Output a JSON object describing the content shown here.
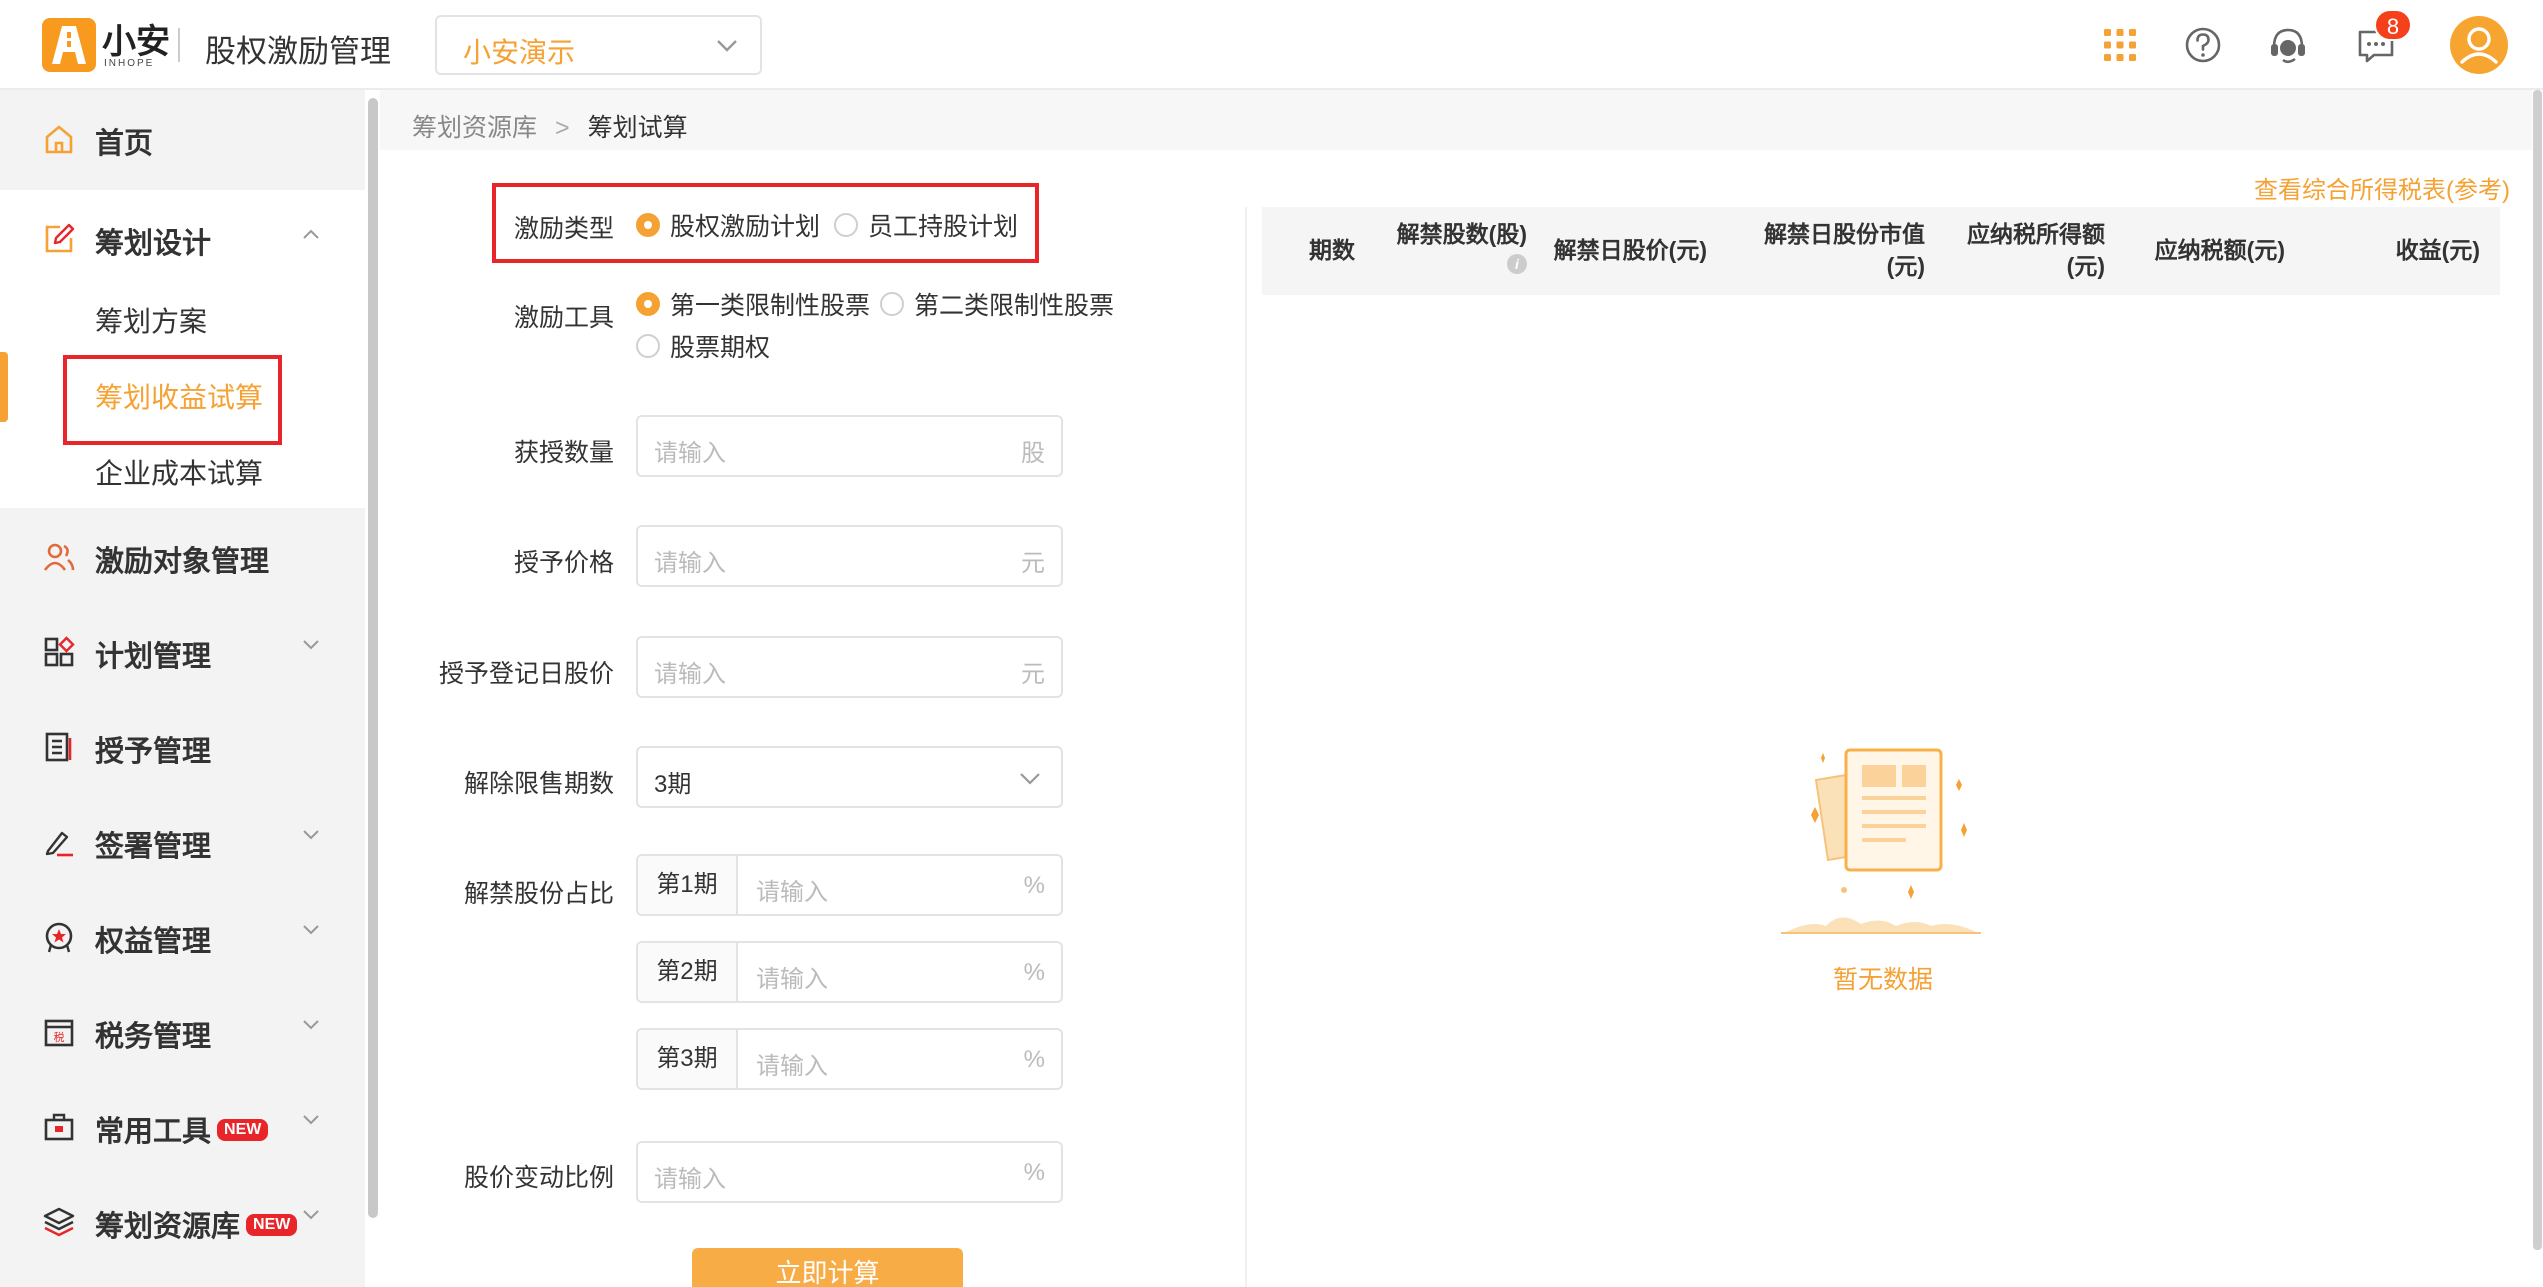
{
  "header": {
    "logo_text": "小安",
    "logo_sub": "INHOPE",
    "app_title": "股权激励管理",
    "tenant": "小安演示",
    "notification_count": "8",
    "icons": [
      "apps-grid-icon",
      "help-icon",
      "support-icon",
      "message-icon",
      "avatar"
    ]
  },
  "sidebar": {
    "home": "首页",
    "design": "筹划设计",
    "design_sub": [
      "筹划方案",
      "筹划收益试算",
      "企业成本试算"
    ],
    "targets": "激励对象管理",
    "plan": "计划管理",
    "grant": "授予管理",
    "sign": "签署管理",
    "equity": "权益管理",
    "tax": "税务管理",
    "tools": "常用工具",
    "library": "筹划资源库",
    "new_tag": "NEW"
  },
  "breadcrumb": {
    "parent": "筹划资源库",
    "current": "筹划试算"
  },
  "form": {
    "type_label": "激励类型",
    "type_options": [
      "股权激励计划",
      "员工持股计划"
    ],
    "tool_label": "激励工具",
    "tool_options": [
      "第一类限制性股票",
      "第二类限制性股票",
      "股票期权"
    ],
    "qty_label": "获授数量",
    "qty_unit": "股",
    "price_label": "授予价格",
    "price_unit": "元",
    "regprice_label": "授予登记日股价",
    "regprice_unit": "元",
    "periods_label": "解除限售期数",
    "periods_value": "3期",
    "ratio_label": "解禁股份占比",
    "ratio_rows": [
      "第1期",
      "第2期",
      "第3期"
    ],
    "ratio_unit": "%",
    "change_label": "股价变动比例",
    "change_unit": "%",
    "placeholder": "请输入",
    "submit": "立即计算"
  },
  "result": {
    "tax_link": "查看综合所得税表(参考)",
    "columns": [
      "期数",
      "解禁股数(股)",
      "解禁日股价(元)",
      "解禁日股份市值",
      "(元)",
      "应纳税所得额",
      "(元)",
      "应纳税额(元)",
      "收益(元)"
    ],
    "info_mark": "i",
    "empty": "暂无数据"
  },
  "colors": {
    "accent": "#f5a133",
    "highlight": "#e8262a",
    "badge": "#f5401c"
  }
}
